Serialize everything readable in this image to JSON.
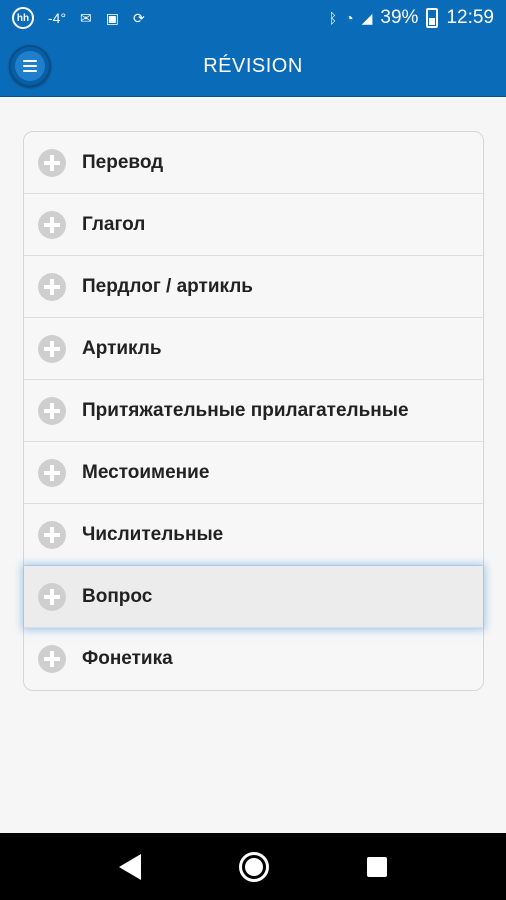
{
  "status_bar": {
    "icons_left": [
      "hh-app-icon",
      "signal-temp-icon",
      "mail-icon",
      "image-icon",
      "sync-icon"
    ],
    "temp_text": "-4°",
    "battery_percent": "39%",
    "time": "12:59"
  },
  "app_bar": {
    "title": "RÉVISION",
    "menu_icon": "hamburger-menu-icon"
  },
  "list": {
    "items": [
      {
        "label": "Перевод"
      },
      {
        "label": "Глагол"
      },
      {
        "label": "Пердлог / артикль"
      },
      {
        "label": "Артикль"
      },
      {
        "label": "Притяжательные прилагательные"
      },
      {
        "label": "Местоимение"
      },
      {
        "label": "Числительные"
      },
      {
        "label": "Вопрос"
      },
      {
        "label": "Фонетика"
      }
    ]
  },
  "colors": {
    "primary": "#0a6bb8",
    "plus_icon": "#cfcfcf",
    "focus_glow": "#5aa0e6"
  }
}
